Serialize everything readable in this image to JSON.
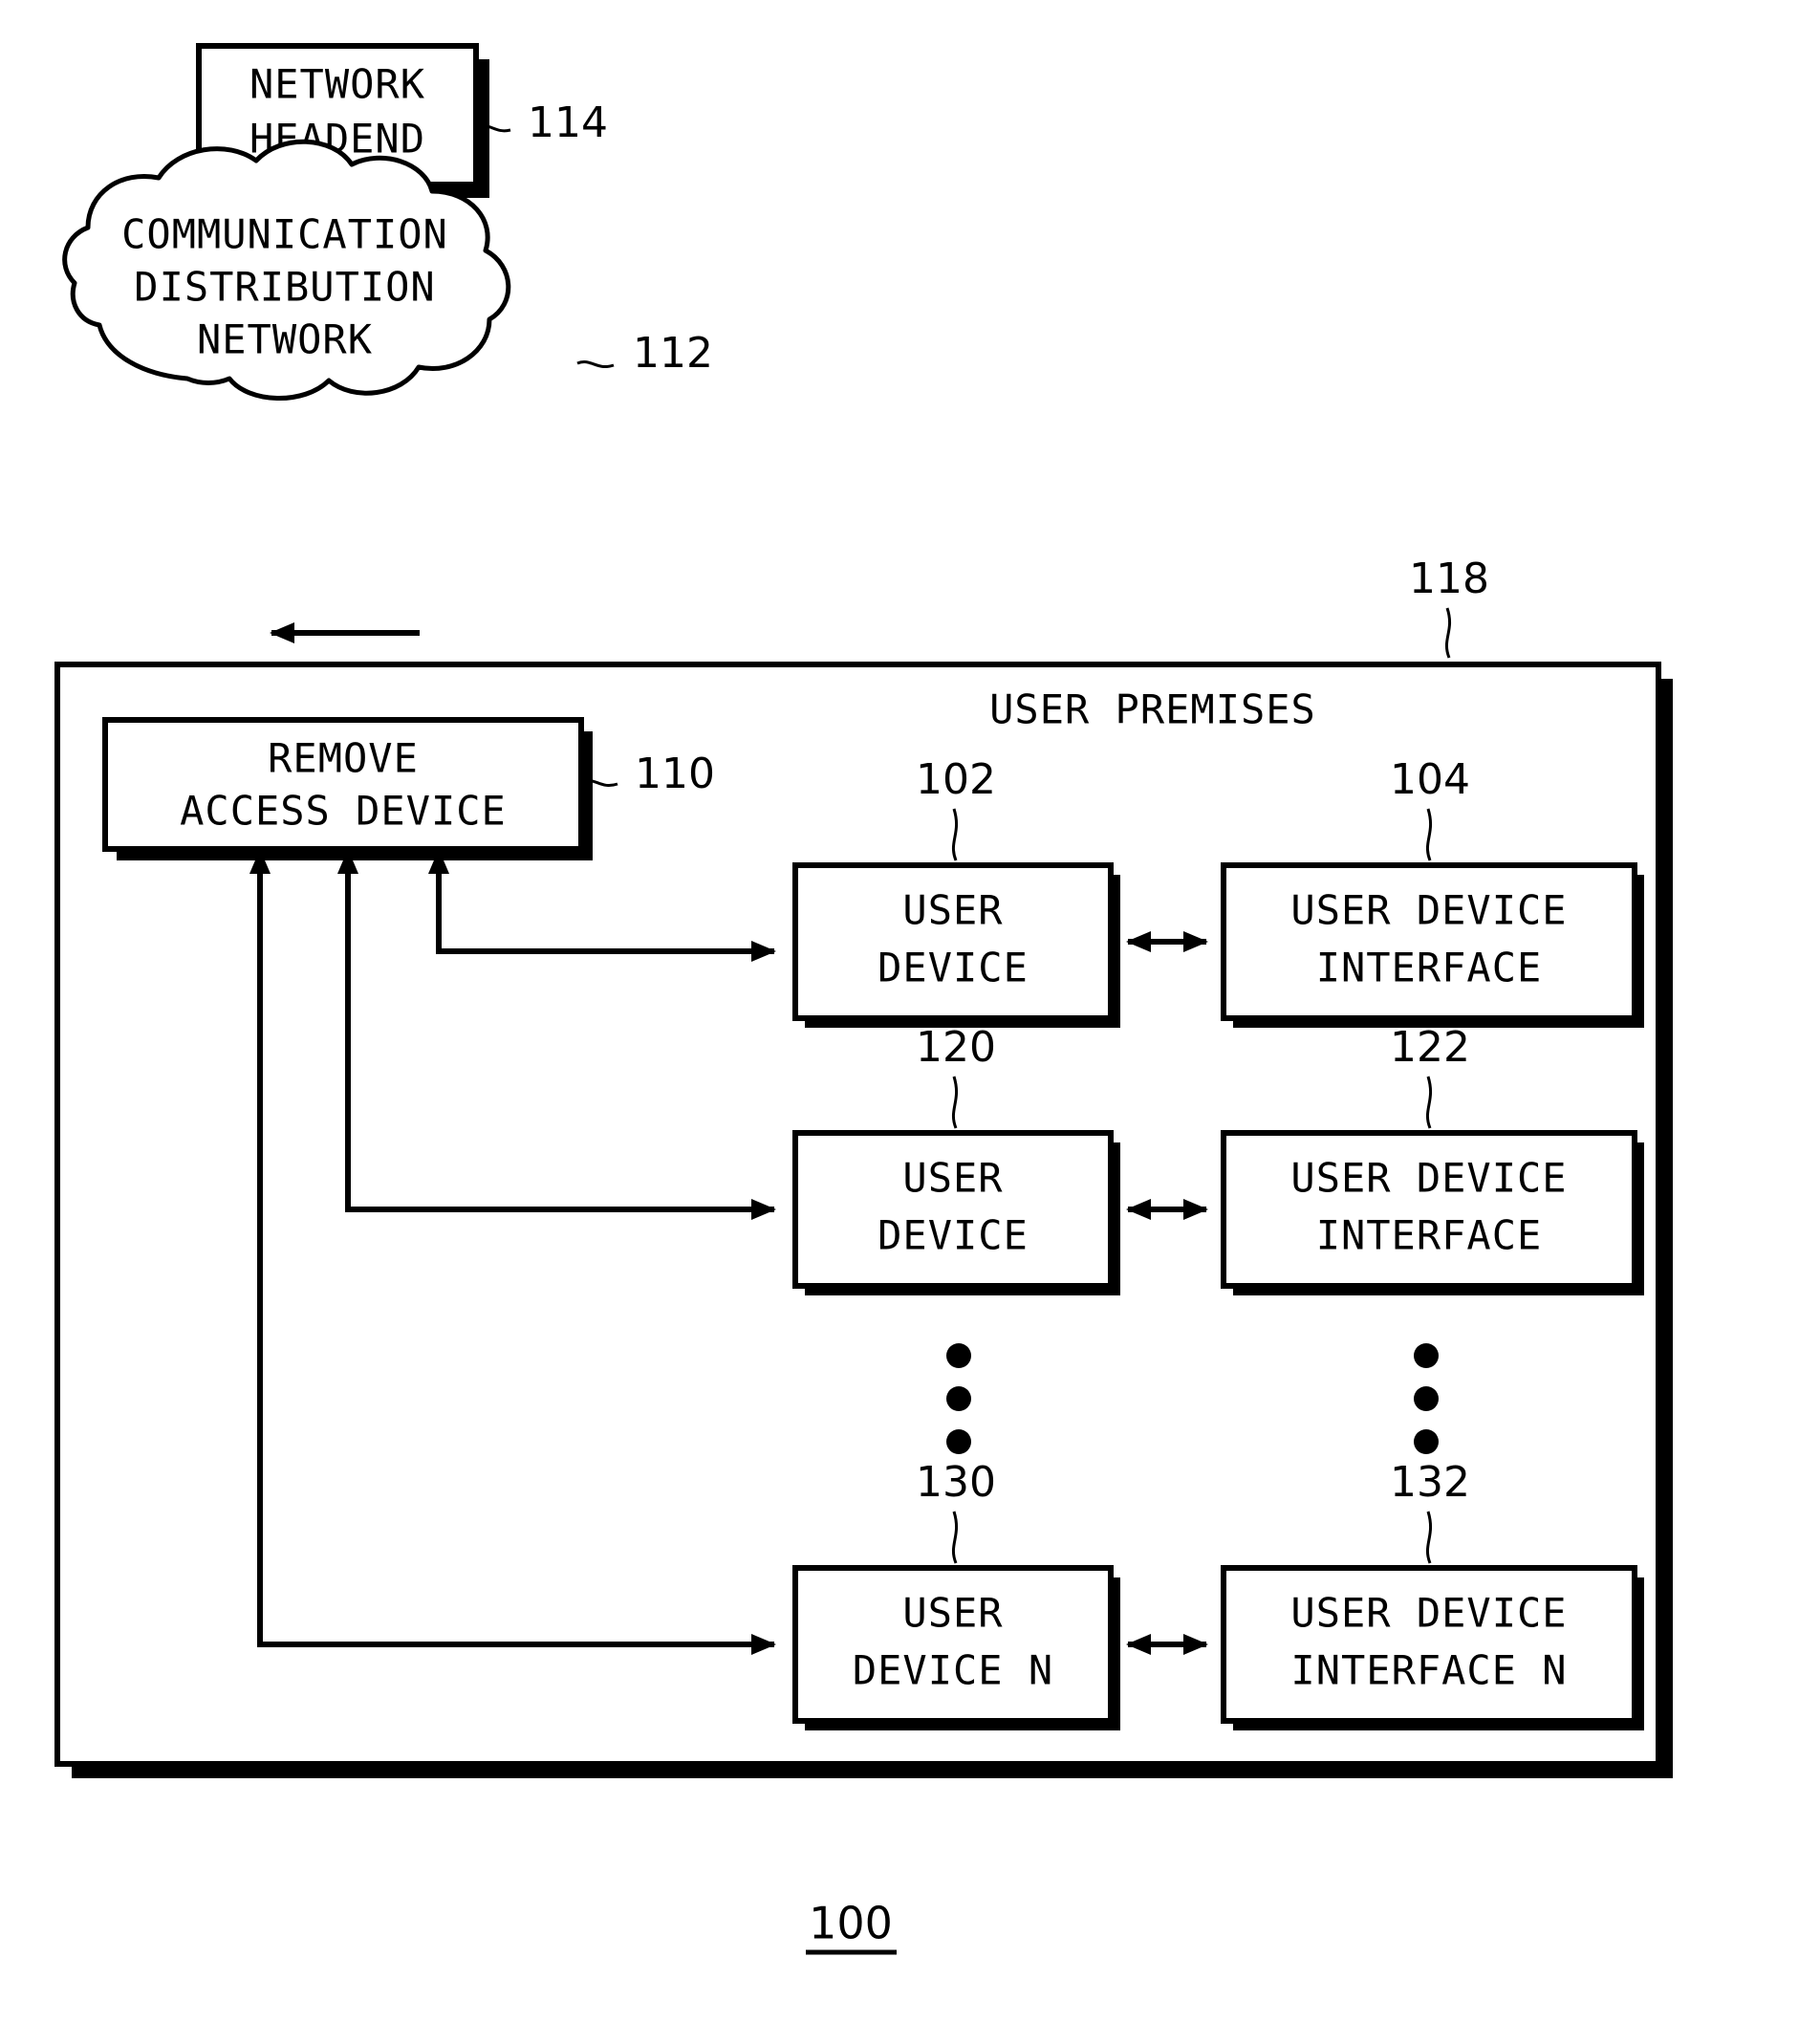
{
  "figure": {
    "number": "100",
    "nodes": {
      "network_headend": {
        "label_line1": "NETWORK",
        "label_line2": "HEADEND",
        "ref": "114"
      },
      "cloud": {
        "label_line1": "COMMUNICATION",
        "label_line2": "DISTRIBUTION",
        "label_line3": "NETWORK",
        "ref": "112"
      },
      "user_premises": {
        "title": "USER PREMISES",
        "ref": "118"
      },
      "remove_access_device": {
        "label_line1": "REMOVE",
        "label_line2": "ACCESS DEVICE",
        "ref": "110"
      }
    },
    "device_rows": [
      {
        "device_line1": "USER",
        "device_line2": "DEVICE",
        "device_ref": "102",
        "interface_line1": "USER DEVICE",
        "interface_line2": "INTERFACE",
        "interface_ref": "104"
      },
      {
        "device_line1": "USER",
        "device_line2": "DEVICE",
        "device_ref": "120",
        "interface_line1": "USER DEVICE",
        "interface_line2": "INTERFACE",
        "interface_ref": "122"
      },
      {
        "device_line1": "USER",
        "device_line2": "DEVICE N",
        "device_ref": "130",
        "interface_line1": "USER DEVICE",
        "interface_line2": "INTERFACE N",
        "interface_ref": "132"
      }
    ],
    "ellipsis_dots": 3,
    "colors": {
      "ink": "#000000",
      "paper": "#ffffff"
    }
  }
}
